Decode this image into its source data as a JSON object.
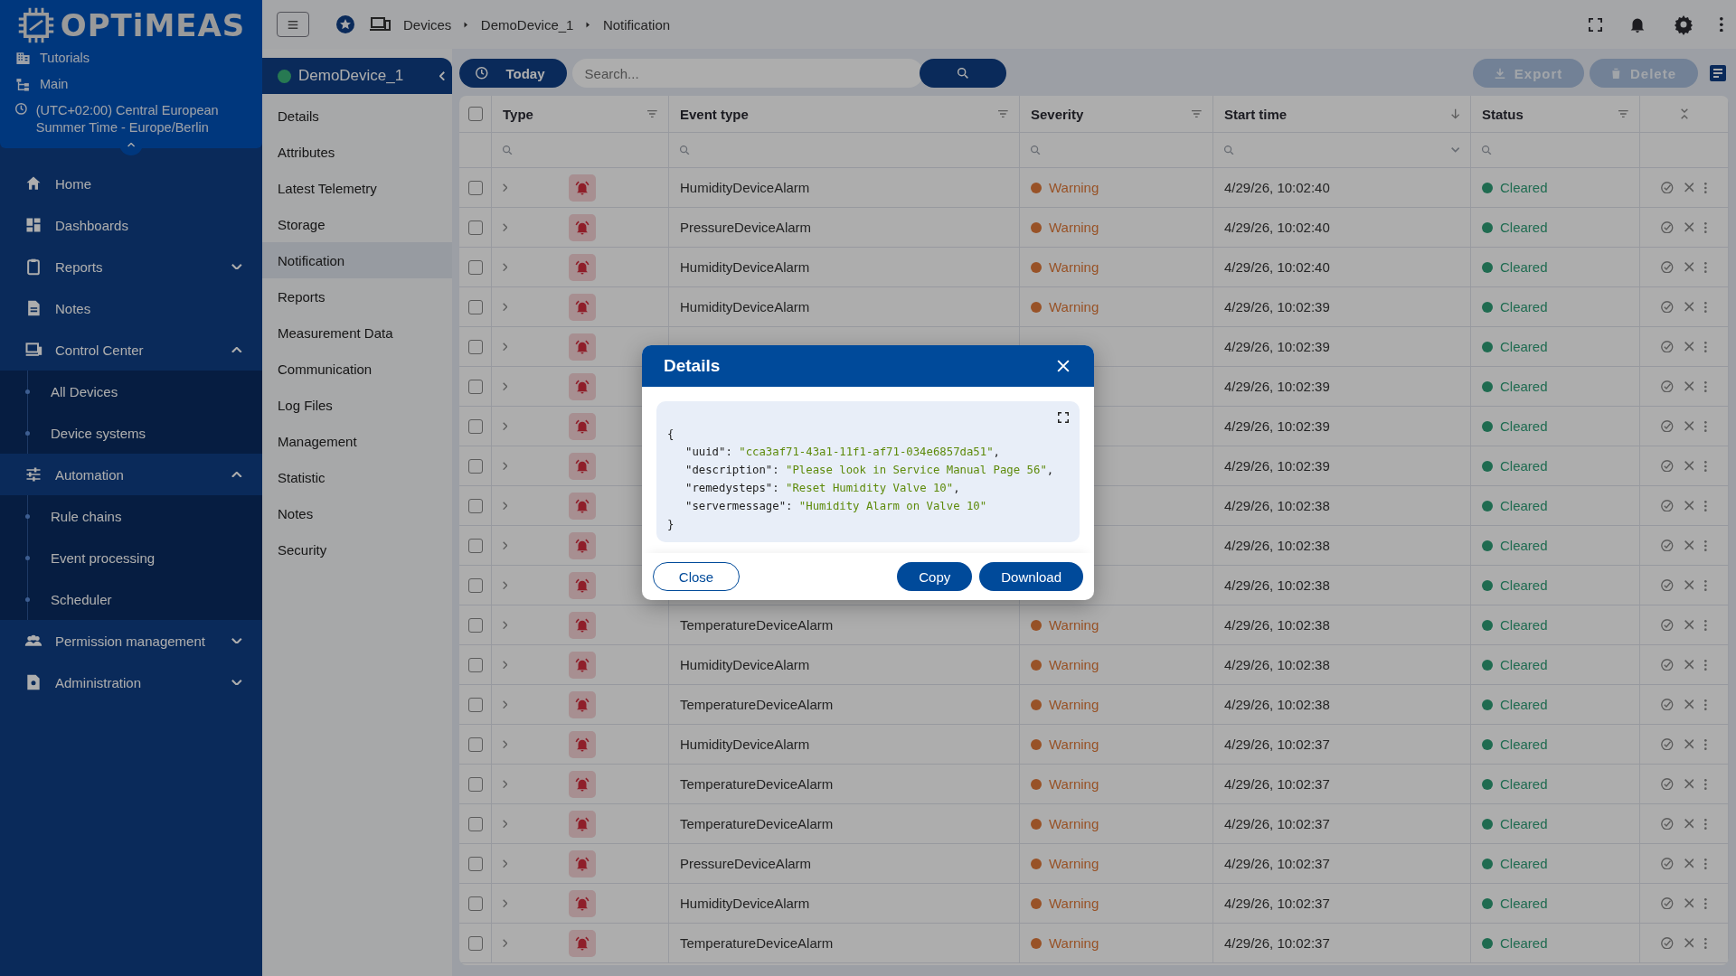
{
  "sidebar": {
    "logo": "OPTiMEAS",
    "info": [
      {
        "kind": "tenant",
        "label": "Tutorials"
      },
      {
        "kind": "hierarchy",
        "label": "Main"
      },
      {
        "kind": "timezone",
        "label": "(UTC+02:00) Central European Summer Time - Europe/Berlin"
      }
    ],
    "nav": [
      {
        "kind": "home",
        "label": "Home"
      },
      {
        "kind": "dashboards",
        "label": "Dashboards"
      },
      {
        "kind": "reports",
        "label": "Reports",
        "expanded": false
      },
      {
        "kind": "notes",
        "label": "Notes"
      },
      {
        "kind": "control",
        "label": "Control Center",
        "expanded": true,
        "children": [
          {
            "label": "All Devices"
          },
          {
            "label": "Device systems"
          }
        ]
      },
      {
        "kind": "automation",
        "label": "Automation",
        "expanded": true,
        "children": [
          {
            "label": "Rule chains"
          },
          {
            "label": "Event processing"
          },
          {
            "label": "Scheduler"
          }
        ]
      },
      {
        "kind": "permissions",
        "label": "Permission management",
        "expanded": false
      },
      {
        "kind": "admin",
        "label": "Administration",
        "expanded": false
      }
    ]
  },
  "top_bar": {
    "breadcrumb": [
      {
        "label": "Devices"
      },
      {
        "label": "DemoDevice_1"
      },
      {
        "label": "Notification"
      }
    ]
  },
  "device_panel": {
    "name": "DemoDevice_1",
    "online": true,
    "items": [
      {
        "label": "Details",
        "selected": false
      },
      {
        "label": "Attributes",
        "selected": false
      },
      {
        "label": "Latest Telemetry",
        "selected": false
      },
      {
        "label": "Storage",
        "selected": false
      },
      {
        "label": "Notification",
        "selected": true
      },
      {
        "label": "Reports",
        "selected": false
      },
      {
        "label": "Measurement Data",
        "selected": false
      },
      {
        "label": "Communication",
        "selected": false
      },
      {
        "label": "Log Files",
        "selected": false
      },
      {
        "label": "Management",
        "selected": false
      },
      {
        "label": "Statistic",
        "selected": false
      },
      {
        "label": "Notes",
        "selected": false
      },
      {
        "label": "Security",
        "selected": false
      }
    ]
  },
  "toolbar": {
    "period": "Today",
    "search": {
      "placeholder": "Search..."
    },
    "buttons": [
      {
        "kind": "export",
        "label": "Export",
        "disabled": true
      },
      {
        "kind": "delete",
        "label": "Delete",
        "disabled": true
      }
    ]
  },
  "table": {
    "select_all": {
      "checked": false
    },
    "columns": [
      {
        "label": "Type",
        "kind": "filter"
      },
      {
        "label": "Event type",
        "kind": "filter"
      },
      {
        "label": "Severity",
        "kind": "filter"
      },
      {
        "label": "Start time",
        "kind": "sort-desc"
      },
      {
        "label": "Status",
        "kind": "filter"
      }
    ],
    "rows": [
      {
        "selected": false,
        "event_type": "HumidityDeviceAlarm",
        "severity": "Warning",
        "start_time": "4/29/26, 10:02:40",
        "status": "Cleared"
      },
      {
        "selected": false,
        "event_type": "PressureDeviceAlarm",
        "severity": "Warning",
        "start_time": "4/29/26, 10:02:40",
        "status": "Cleared"
      },
      {
        "selected": false,
        "event_type": "HumidityDeviceAlarm",
        "severity": "Warning",
        "start_time": "4/29/26, 10:02:40",
        "status": "Cleared"
      },
      {
        "selected": false,
        "event_type": "HumidityDeviceAlarm",
        "severity": "Warning",
        "start_time": "4/29/26, 10:02:39",
        "status": "Cleared"
      },
      {
        "selected": false,
        "start_time": "4/29/26, 10:02:39",
        "status": "Cleared"
      },
      {
        "selected": false,
        "start_time": "4/29/26, 10:02:39",
        "status": "Cleared"
      },
      {
        "selected": false,
        "start_time": "4/29/26, 10:02:39",
        "status": "Cleared"
      },
      {
        "selected": false,
        "start_time": "4/29/26, 10:02:39",
        "status": "Cleared"
      },
      {
        "selected": false,
        "start_time": "4/29/26, 10:02:38",
        "status": "Cleared"
      },
      {
        "selected": false,
        "start_time": "4/29/26, 10:02:38",
        "status": "Cleared"
      },
      {
        "selected": false,
        "start_time": "4/29/26, 10:02:38",
        "status": "Cleared"
      },
      {
        "selected": false,
        "event_type": "TemperatureDeviceAlarm",
        "severity": "Warning",
        "start_time": "4/29/26, 10:02:38",
        "status": "Cleared"
      },
      {
        "selected": false,
        "event_type": "HumidityDeviceAlarm",
        "severity": "Warning",
        "start_time": "4/29/26, 10:02:38",
        "status": "Cleared"
      },
      {
        "selected": false,
        "event_type": "TemperatureDeviceAlarm",
        "severity": "Warning",
        "start_time": "4/29/26, 10:02:38",
        "status": "Cleared"
      },
      {
        "selected": false,
        "event_type": "HumidityDeviceAlarm",
        "severity": "Warning",
        "start_time": "4/29/26, 10:02:37",
        "status": "Cleared"
      },
      {
        "selected": false,
        "event_type": "TemperatureDeviceAlarm",
        "severity": "Warning",
        "start_time": "4/29/26, 10:02:37",
        "status": "Cleared"
      },
      {
        "selected": false,
        "event_type": "TemperatureDeviceAlarm",
        "severity": "Warning",
        "start_time": "4/29/26, 10:02:37",
        "status": "Cleared"
      },
      {
        "selected": false,
        "event_type": "PressureDeviceAlarm",
        "severity": "Warning",
        "start_time": "4/29/26, 10:02:37",
        "status": "Cleared"
      },
      {
        "selected": false,
        "event_type": "HumidityDeviceAlarm",
        "severity": "Warning",
        "start_time": "4/29/26, 10:02:37",
        "status": "Cleared"
      },
      {
        "selected": false,
        "event_type": "TemperatureDeviceAlarm",
        "severity": "Warning",
        "start_time": "4/29/26, 10:02:37",
        "status": "Cleared"
      }
    ]
  },
  "dialog": {
    "title": "Details",
    "open_brace": "{",
    "close_brace": "}",
    "lines": [
      {
        "key": "\"uuid\":",
        "value": "\"cca3af71-43a1-11f1-af71-034e6857da51\"",
        "end": ","
      },
      {
        "key": "\"description\":",
        "value": "\"Please look in Service Manual Page 56\"",
        "end": ","
      },
      {
        "key": "\"remedysteps\":",
        "value": "\"Reset Humidity Valve 10\"",
        "end": ","
      },
      {
        "key": "\"servermessage\":",
        "value": "\"Humidity Alarm on Valve 10\""
      }
    ],
    "buttons": [
      {
        "kind": "outline",
        "label": "Close"
      },
      {
        "kind": "primary",
        "label": "Copy"
      },
      {
        "kind": "primary",
        "label": "Download"
      }
    ]
  }
}
